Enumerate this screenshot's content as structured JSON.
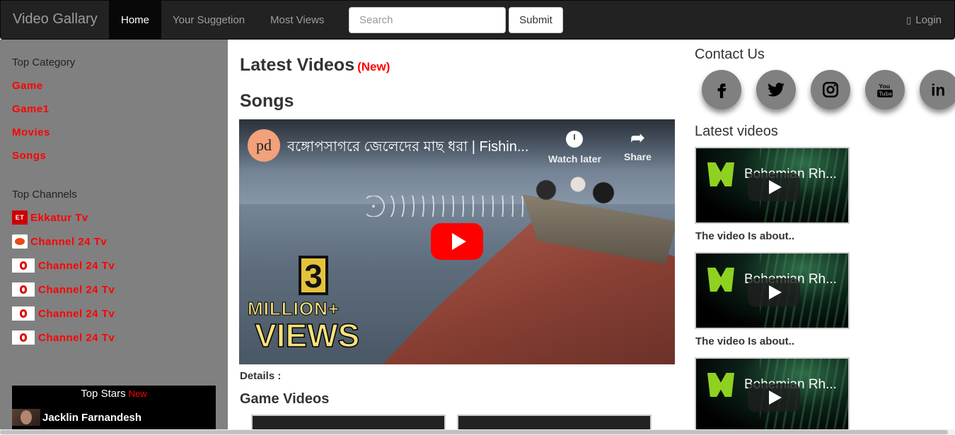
{
  "navbar": {
    "brand": "Video Gallary",
    "items": [
      {
        "label": "Home",
        "active": true
      },
      {
        "label": "Your Suggetion",
        "active": false
      },
      {
        "label": "Most Views",
        "active": false
      }
    ],
    "search_placeholder": "Search",
    "submit_label": "Submit",
    "login_label": "Login",
    "login_icon": "user-icon"
  },
  "sidebar": {
    "category_heading": "Top Category",
    "categories": [
      "Game",
      "Game1",
      "Movies",
      "Songs"
    ],
    "channels_heading": "Top Channels",
    "channels": [
      {
        "name": "Ekkatur Tv",
        "logo": "ekkatur-logo"
      },
      {
        "name": "Channel 24 Tv",
        "logo": "channel24-logo"
      },
      {
        "name": "Channel 24 Tv",
        "logo": "independent-logo"
      },
      {
        "name": "Channel 24 Tv",
        "logo": "independent-logo"
      },
      {
        "name": "Channel 24 Tv",
        "logo": "independent-logo"
      },
      {
        "name": "Channel 24 Tv",
        "logo": "independent-logo"
      }
    ],
    "stars": {
      "title": "Top Stars",
      "badge": "New",
      "items": [
        {
          "name": "Jacklin Farnandesh"
        }
      ]
    }
  },
  "main": {
    "title": "Latest Videos",
    "title_badge": "(New)",
    "section_title": "Songs",
    "player": {
      "channel_avatar": "pd",
      "video_title": "বঙ্গোপসাগরে জেলেদের মাছ ধরা | Fishin...",
      "watch_later": "Watch later",
      "share": "Share",
      "thumb_number": "3",
      "thumb_million": "MILLION+",
      "thumb_views": "VIEWS"
    },
    "details_label": "Details :",
    "game_section_title": "Game Videos"
  },
  "right": {
    "contact_title": "Contact Us",
    "social": [
      {
        "name": "facebook-icon"
      },
      {
        "name": "twitter-icon"
      },
      {
        "name": "instagram-icon"
      },
      {
        "name": "youtube-icon",
        "text": "You Tube"
      },
      {
        "name": "linkedin-icon",
        "text": "in"
      }
    ],
    "latest_title": "Latest videos",
    "videos": [
      {
        "title": "Bohemian Rh...",
        "caption": "The video Is about.."
      },
      {
        "title": "Bohemian Rh...",
        "caption": "The video Is about.."
      },
      {
        "title": "Bohemian Rh...",
        "caption": ""
      }
    ]
  },
  "colors": {
    "navbar_bg": "#222222",
    "sidebar_bg": "#808080",
    "link_red": "#ff0000",
    "youtube_red": "#ff0000"
  }
}
